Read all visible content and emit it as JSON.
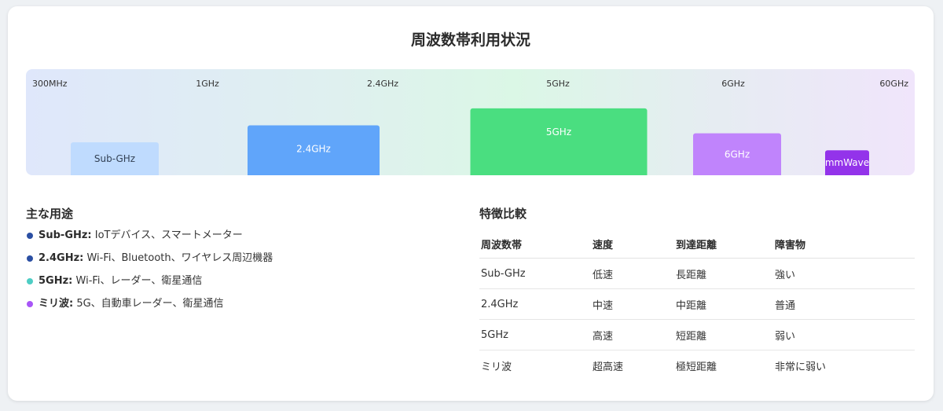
{
  "page": {
    "title": "周波数帯利用状況"
  },
  "chart_data": {
    "type": "bar",
    "axis_ticks": [
      "300MHz",
      "1GHz",
      "2.4GHz",
      "5GHz",
      "6GHz",
      "60GHz"
    ],
    "categories": [
      "Sub-GHz",
      "2.4GHz",
      "5GHz",
      "6GHz",
      "mmWave"
    ],
    "values": [
      33,
      50,
      67,
      42,
      25
    ],
    "colors": [
      "#bfdbfe",
      "#60a5fa",
      "#4ade80",
      "#c084fc",
      "#9333ea"
    ],
    "label_colors": [
      "#334155",
      "#ffffff",
      "#ffffff",
      "#ffffff",
      "#ffffff"
    ],
    "ylim": [
      0,
      100
    ],
    "grid": false,
    "legend": "none"
  },
  "uses": {
    "heading": "主な用途",
    "items": [
      {
        "band": "Sub-GHz:",
        "text": " IoTデバイス、スマートメーター",
        "dot_color": "#2b4fa3"
      },
      {
        "band": "2.4GHz:",
        "text": " Wi-Fi、Bluetooth、ワイヤレス周辺機器",
        "dot_color": "#2b4fa3"
      },
      {
        "band": "5GHz:",
        "text": " Wi-Fi、レーダー、衛星通信",
        "dot_color": "#4ecdc4"
      },
      {
        "band": "ミリ波:",
        "text": " 5G、自動車レーダー、衛星通信",
        "dot_color": "#a855f7"
      }
    ]
  },
  "comparison": {
    "heading": "特徴比較",
    "headers": [
      "周波数帯",
      "速度",
      "到達距離",
      "障害物"
    ],
    "rows": [
      [
        "Sub-GHz",
        "低速",
        "長距離",
        "強い"
      ],
      [
        "2.4GHz",
        "中速",
        "中距離",
        "普通"
      ],
      [
        "5GHz",
        "高速",
        "短距離",
        "弱い"
      ],
      [
        "ミリ波",
        "超高速",
        "極短距離",
        "非常に弱い"
      ]
    ]
  }
}
